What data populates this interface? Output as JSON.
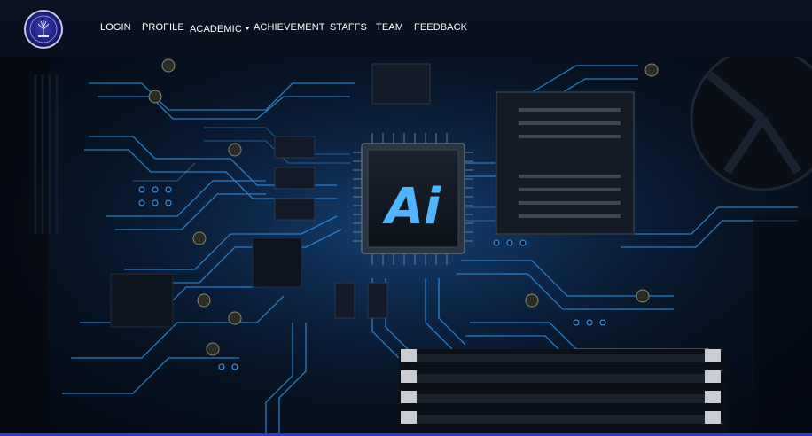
{
  "navbar": {
    "logo_icon": "college-emblem-icon",
    "items": [
      {
        "label": "LOGIN"
      },
      {
        "label": "PROFILE"
      },
      {
        "label": "ACADEMIC",
        "has_dropdown": true
      },
      {
        "label": "ACHIEVEMENT"
      },
      {
        "label": "STAFFS"
      },
      {
        "label": "TEAM"
      },
      {
        "label": "FEEDBACK"
      }
    ]
  },
  "hero": {
    "chip_text": "Ai",
    "accent_color": "#2fa8ff"
  }
}
